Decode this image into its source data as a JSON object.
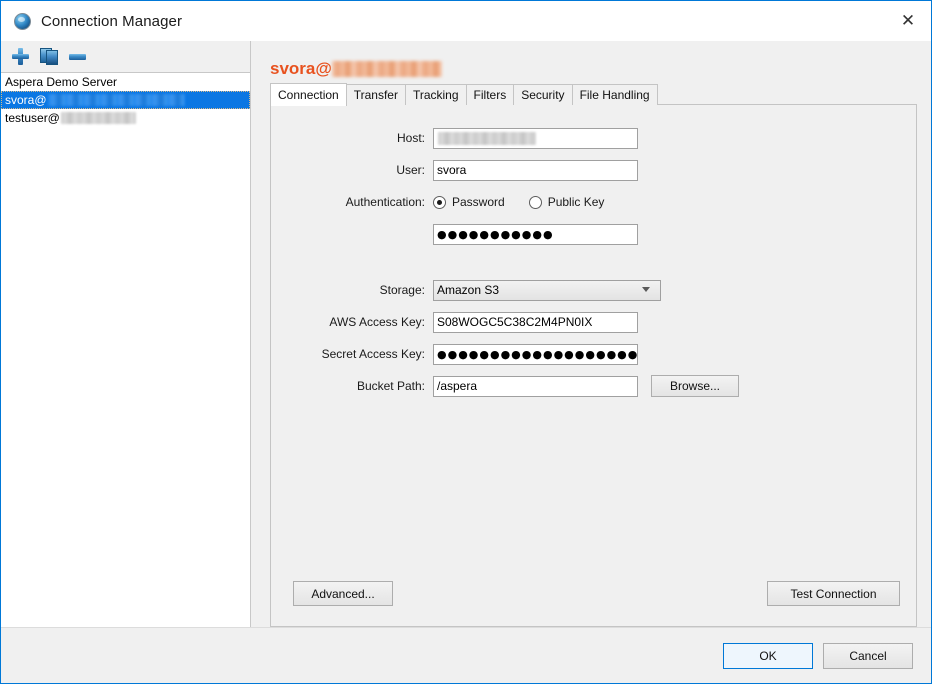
{
  "window": {
    "title": "Connection Manager",
    "app_icon": "aspera-orb-icon",
    "close_label": "✕"
  },
  "left_pane": {
    "toolbar": {
      "add_label": "+",
      "duplicate_label": "duplicate",
      "remove_label": "−"
    },
    "servers": [
      {
        "label": "Aspera Demo Server",
        "redacted": false,
        "redact_width": 0,
        "selected": false
      },
      {
        "label": "svora@",
        "redacted": true,
        "redact_width": 137,
        "selected": true
      },
      {
        "label": "testuser@",
        "redacted": true,
        "redact_width": 75,
        "selected": false
      }
    ]
  },
  "right_pane": {
    "connection_title": "svora@",
    "connection_title_redact_width": 110,
    "title_color": "#e8521f",
    "tabs": [
      {
        "label": "Connection",
        "active": true
      },
      {
        "label": "Transfer",
        "active": false
      },
      {
        "label": "Tracking",
        "active": false
      },
      {
        "label": "Filters",
        "active": false
      },
      {
        "label": "Security",
        "active": false
      },
      {
        "label": "File Handling",
        "active": false
      }
    ],
    "form": {
      "host_label": "Host:",
      "host_value": "",
      "host_redacted": true,
      "host_redact_width": 98,
      "user_label": "User:",
      "user_value": "svora",
      "auth_label": "Authentication:",
      "auth_options": [
        {
          "label": "Password",
          "selected": true
        },
        {
          "label": "Public Key",
          "selected": false
        }
      ],
      "password_value": "●●●●●●●●●●●",
      "storage_label": "Storage:",
      "storage_value": "Amazon S3",
      "storage_options": [
        "Amazon S3"
      ],
      "aws_access_key_label": "AWS Access Key:",
      "aws_access_key_value": "S08WOGC5C38C2M4PN0IX",
      "secret_access_key_label": "Secret Access Key:",
      "secret_access_key_value": "●●●●●●●●●●●●●●●●●●●●●●●●●●●●",
      "bucket_path_label": "Bucket Path:",
      "bucket_path_value": "/aspera",
      "browse_label": "Browse..."
    },
    "panel_buttons": {
      "advanced_label": "Advanced...",
      "test_connection_label": "Test Connection"
    }
  },
  "footer": {
    "ok_label": "OK",
    "cancel_label": "Cancel"
  }
}
